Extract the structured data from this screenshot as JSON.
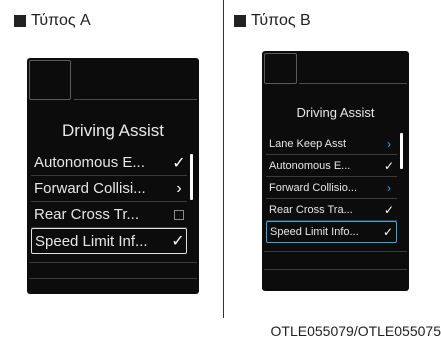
{
  "panels": {
    "a": {
      "heading": "Τύπος A",
      "title": "Driving Assist",
      "items": [
        {
          "label": "Autonomous E...",
          "control": "check"
        },
        {
          "label": "Forward Collisi...",
          "control": "arrow"
        },
        {
          "label": "Rear Cross Tr...",
          "control": "unchecked"
        },
        {
          "label": "Speed Limit Inf...",
          "control": "check"
        }
      ]
    },
    "b": {
      "heading": "Τύπος B",
      "title": "Driving Assist",
      "items": [
        {
          "label": "Lane Keep Asst",
          "control": "arrow"
        },
        {
          "label": "Autonomous E...",
          "control": "check"
        },
        {
          "label": "Forward Collisio...",
          "control": "arrow"
        },
        {
          "label": "Rear Cross Tra...",
          "control": "check"
        },
        {
          "label": "Speed Limit Info...",
          "control": "check"
        }
      ]
    }
  },
  "icons": {
    "check": "✓",
    "arrow": "›"
  },
  "colors": {
    "screen_bg": "#0c0c0c",
    "accent_blue": "#3aa7e8"
  },
  "caption": "OTLE055079/OTLE055075"
}
